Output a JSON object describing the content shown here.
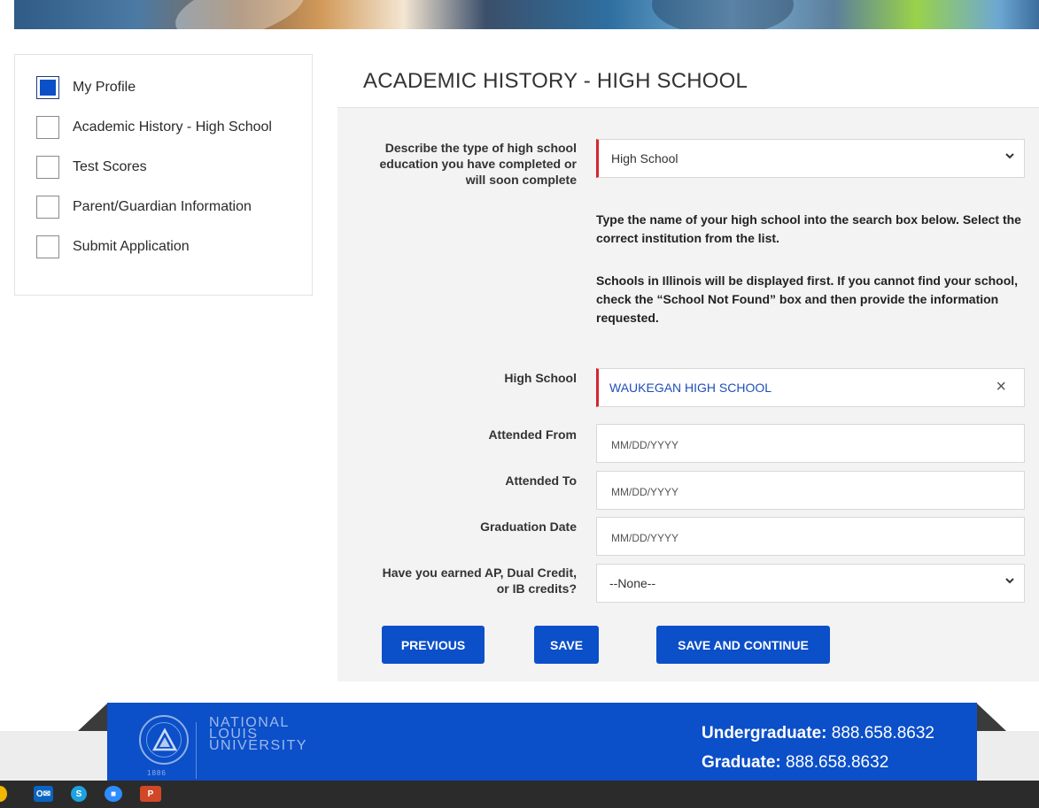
{
  "sidebar": {
    "items": [
      {
        "label": "My Profile",
        "checked": true
      },
      {
        "label": "Academic History - High School",
        "checked": false
      },
      {
        "label": "Test Scores",
        "checked": false
      },
      {
        "label": "Parent/Guardian Information",
        "checked": false
      },
      {
        "label": "Submit Application",
        "checked": false
      }
    ]
  },
  "main": {
    "title": "ACADEMIC HISTORY - HIGH SCHOOL",
    "education_type": {
      "label": [
        "Describe the type of high school",
        "education you have completed or",
        "will soon complete"
      ],
      "value": "High School"
    },
    "instructions": {
      "p1": "Type the name of your high school into the search box below. Select the correct institution from the list.",
      "p2": "Schools in Illinois will be displayed first. If you cannot find your school, check the “School Not Found” box and then provide the information requested."
    },
    "high_school": {
      "label": "High School",
      "value": "WAUKEGAN HIGH SCHOOL",
      "clear_icon": "×"
    },
    "attended_from": {
      "label": "Attended From",
      "placeholder": "MM/DD/YYYY"
    },
    "attended_to": {
      "label": "Attended To",
      "placeholder": "MM/DD/YYYY"
    },
    "graduation_date": {
      "label": "Graduation Date",
      "placeholder": "MM/DD/YYYY"
    },
    "ap_credits": {
      "label": [
        "Have you earned AP, Dual Credit,",
        "or IB credits?"
      ],
      "value": "--None--"
    },
    "buttons": {
      "previous": "PREVIOUS",
      "save": "SAVE",
      "save_continue": "SAVE AND CONTINUE"
    }
  },
  "footer": {
    "logo": [
      "NATIONAL",
      "LOUIS",
      "UNIVERSITY"
    ],
    "year": "1886",
    "undergrad_label": "Undergraduate:",
    "undergrad_phone": "888.658.8632",
    "grad_label": "Graduate:",
    "grad_phone": "888.658.8632"
  },
  "taskbar": {
    "icons": [
      "chrome-icon",
      "outlook-icon",
      "skype-icon",
      "zoom-icon",
      "powerpoint-icon"
    ]
  },
  "colors": {
    "accent": "#0b4fc9",
    "required": "#d3262e",
    "panel_bg": "#f3f3f3",
    "taskbar": "#2b2b2b"
  }
}
